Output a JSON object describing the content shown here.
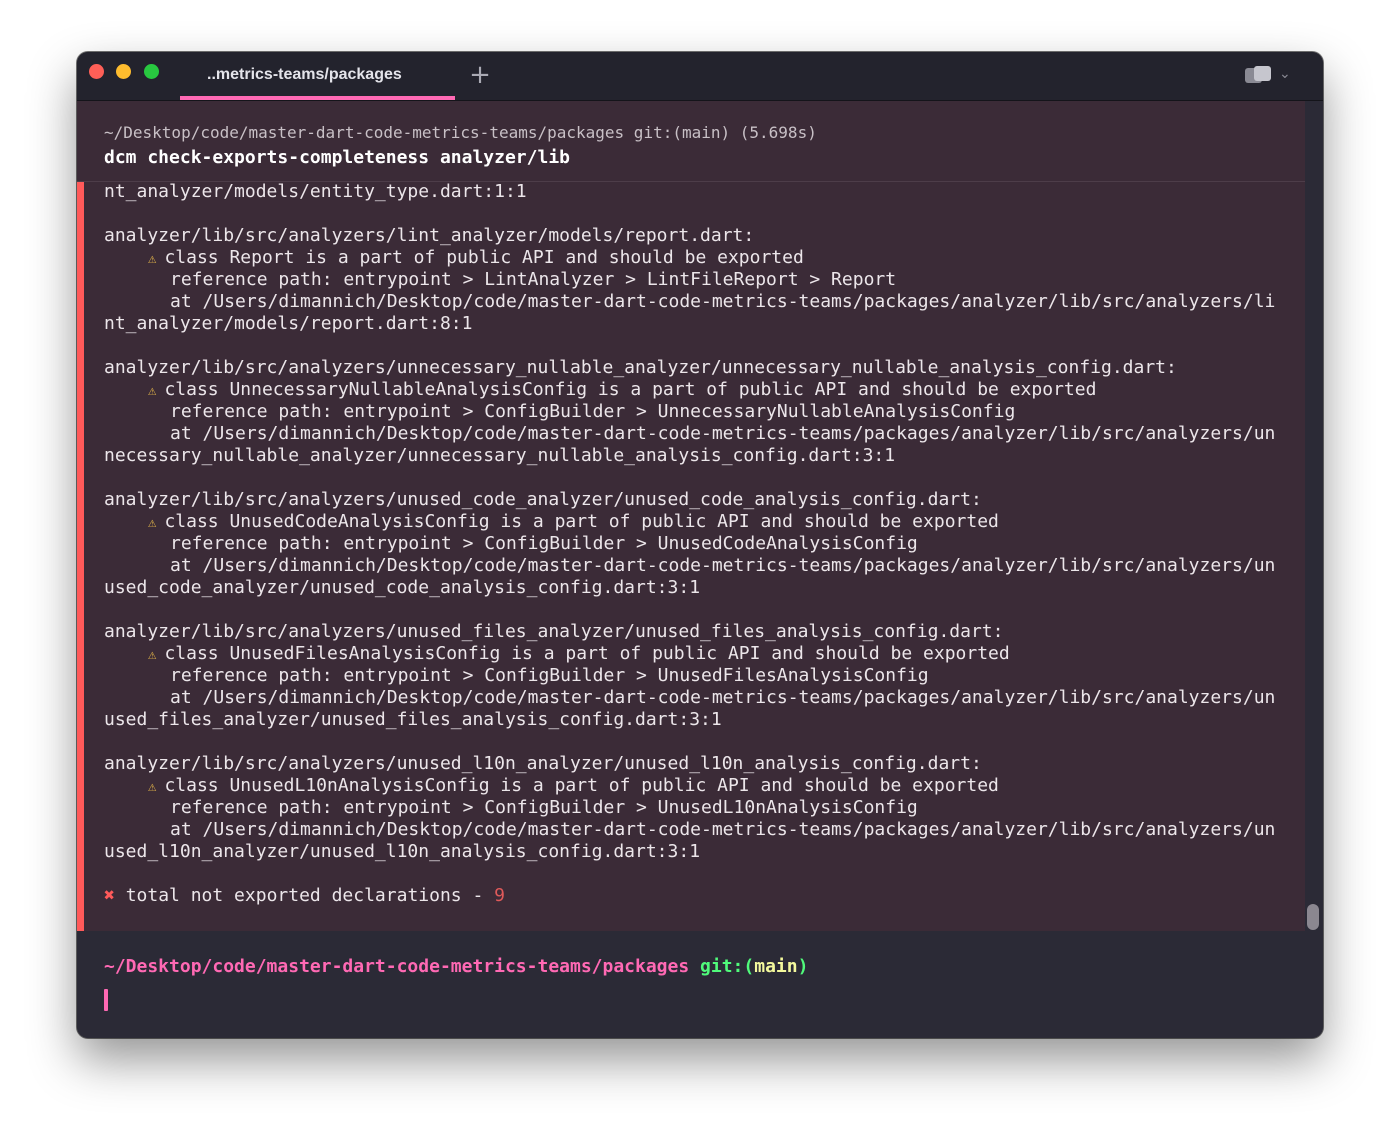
{
  "tab": {
    "title": "..metrics-teams/packages",
    "new_tab_icon": "+"
  },
  "block": {
    "path_info": "~/Desktop/code/master-dart-code-metrics-teams/packages git:(main) (5.698s)",
    "command": "dcm check-exports-completeness analyzer/lib",
    "partial_line": "nt_analyzer/models/entity_type.dart:1:1",
    "issues": [
      {
        "file": "analyzer/lib/src/analyzers/lint_analyzer/models/report.dart:",
        "message": "class Report is a part of public API and should be exported",
        "reference": "reference path: entrypoint > LintAnalyzer > LintFileReport > Report",
        "location": "at /Users/dimannich/Desktop/code/master-dart-code-metrics-teams/packages/analyzer/lib/src/analyzers/li",
        "location_cont": "nt_analyzer/models/report.dart:8:1"
      },
      {
        "file": "analyzer/lib/src/analyzers/unnecessary_nullable_analyzer/unnecessary_nullable_analysis_config.dart:",
        "message": "class UnnecessaryNullableAnalysisConfig is a part of public API and should be exported",
        "reference": "reference path: entrypoint > ConfigBuilder > UnnecessaryNullableAnalysisConfig",
        "location": "at /Users/dimannich/Desktop/code/master-dart-code-metrics-teams/packages/analyzer/lib/src/analyzers/un",
        "location_cont": "necessary_nullable_analyzer/unnecessary_nullable_analysis_config.dart:3:1"
      },
      {
        "file": "analyzer/lib/src/analyzers/unused_code_analyzer/unused_code_analysis_config.dart:",
        "message": "class UnusedCodeAnalysisConfig is a part of public API and should be exported",
        "reference": "reference path: entrypoint > ConfigBuilder > UnusedCodeAnalysisConfig",
        "location": "at /Users/dimannich/Desktop/code/master-dart-code-metrics-teams/packages/analyzer/lib/src/analyzers/un",
        "location_cont": "used_code_analyzer/unused_code_analysis_config.dart:3:1"
      },
      {
        "file": "analyzer/lib/src/analyzers/unused_files_analyzer/unused_files_analysis_config.dart:",
        "message": "class UnusedFilesAnalysisConfig is a part of public API and should be exported",
        "reference": "reference path: entrypoint > ConfigBuilder > UnusedFilesAnalysisConfig",
        "location": "at /Users/dimannich/Desktop/code/master-dart-code-metrics-teams/packages/analyzer/lib/src/analyzers/un",
        "location_cont": "used_files_analyzer/unused_files_analysis_config.dart:3:1"
      },
      {
        "file": "analyzer/lib/src/analyzers/unused_l10n_analyzer/unused_l10n_analysis_config.dart:",
        "message": "class UnusedL10nAnalysisConfig is a part of public API and should be exported",
        "reference": "reference path: entrypoint > ConfigBuilder > UnusedL10nAnalysisConfig",
        "location": "at /Users/dimannich/Desktop/code/master-dart-code-metrics-teams/packages/analyzer/lib/src/analyzers/un",
        "location_cont": "used_l10n_analyzer/unused_l10n_analysis_config.dart:3:1"
      }
    ],
    "warning_glyph": "⚠",
    "summary": {
      "icon": "✖",
      "text": "total not exported declarations - ",
      "count": "9"
    }
  },
  "prompt": {
    "path": "~/Desktop/code/master-dart-code-metrics-teams/packages",
    "git_label": "git:",
    "paren_open": "(",
    "branch": "main",
    "paren_close": ")"
  },
  "colors": {
    "block_bg": "#3b2b37",
    "accent": "#ff5a5a",
    "prompt_path": "#ff69b4",
    "git": "#50fa7b",
    "branch": "#f4f99d",
    "warning": "#e7b84a"
  }
}
